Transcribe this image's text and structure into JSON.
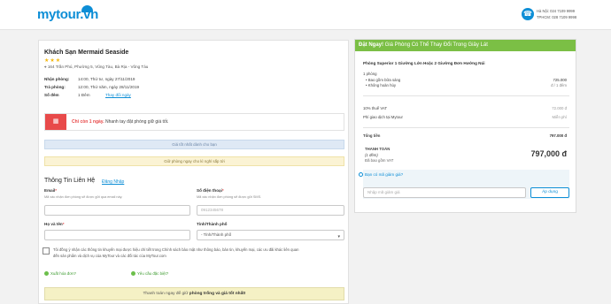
{
  "header": {
    "logo": "mytour.vn",
    "hotline_hn": "Hà Nội: 024 7109 9999",
    "hotline_hcm": "TPHCM: 028 7109 9998"
  },
  "hotel": {
    "name": "Khách Sạn Mermaid Seaside",
    "stars": "★★★",
    "address": "164 Trần Phú, Phường 5, Vũng Tàu, Bà Rịa - Vũng Tàu",
    "checkin_label": "Nhận phòng:",
    "checkin_value": "14:00, Thứ tư, ngày 27/11/2019",
    "checkout_label": "Trả phòng:",
    "checkout_value": "12:00, Thứ năm, ngày 28/11/2019",
    "nights_label": "Số đêm",
    "nights_value": "1 Đêm",
    "change_link": "Thay đổi ngày"
  },
  "alert": {
    "icon": "calendar-icon",
    "bold": "Chỉ còn 1 ngày.",
    "text": " Nhanh tay đặt phòng giữ giá tốt."
  },
  "notices": {
    "best_price": "Giá tốt nhất dành cho bạn",
    "book_now": "Giữ phòng ngay cho kì nghỉ sắp tới"
  },
  "contact": {
    "title": "Thông Tin Liên Hệ",
    "login": "Đăng Nhập",
    "email_label": "Email",
    "email_hint": "Mã xác nhận đơn phòng sẽ được gửi qua email này.",
    "phone_label": "Số điện thoại",
    "phone_hint": "Mã xác nhận đơn phòng sẽ được gửi SMS.",
    "phone_placeholder": "0912345678",
    "name_label": "Họ và tên",
    "city_label": "Tỉnh/Thành phố",
    "city_value": "- Tỉnh/Thành phố",
    "consent_1": "Tôi đồng ý nhận các thông tin khuyến mại được hiệu chỉ tiết trong Chính sách bảo mật như thông báo, bản tin, khuyến mại, các ưu đãi khác liên quan",
    "consent_2": "đến sản phẩm và dịch vụ của MyTour và các đối tác của MyTour.com",
    "invoice": "Xuất hóa đơn?",
    "special_request": "Yêu cầu đặc biệt?",
    "submit_pre": "Thanh toán ngay để giữ ",
    "submit_bold": "phòng trống và giá tốt nhất!"
  },
  "summary": {
    "head_bold": "Đặt Ngay!",
    "head_text": " Giá Phòng Có Thể Thay Đổi Trong Giây Lát",
    "room_name": "Phòng Superior 1 Giường Lớn Hoặc 2 Giường Đơn Hướng Núi",
    "qty": "1 phòng",
    "breakfast": "Bao gồm bữa sáng",
    "refund": "Không hoàn hủy",
    "room_price": "725.000",
    "room_unit": "đ / 1 đêm",
    "vat_label": "10% thuế VAT",
    "vat_value": "72.000 đ",
    "fee_label": "Phí giao dịch tại Mytour",
    "fee_value": "Miễn phí",
    "total_label": "Tổng tiền",
    "total_value": "797.000 đ",
    "pay_label": "THANH TOÁN",
    "pay_sub1": "(1 đêm)",
    "pay_sub2": "Đã bao gồm VAT",
    "pay_value": "797,000 đ",
    "promo_question": "Bạn có mã giảm giá?",
    "promo_placeholder": "Nhập mã giảm giá",
    "apply": "Áp dụng"
  }
}
